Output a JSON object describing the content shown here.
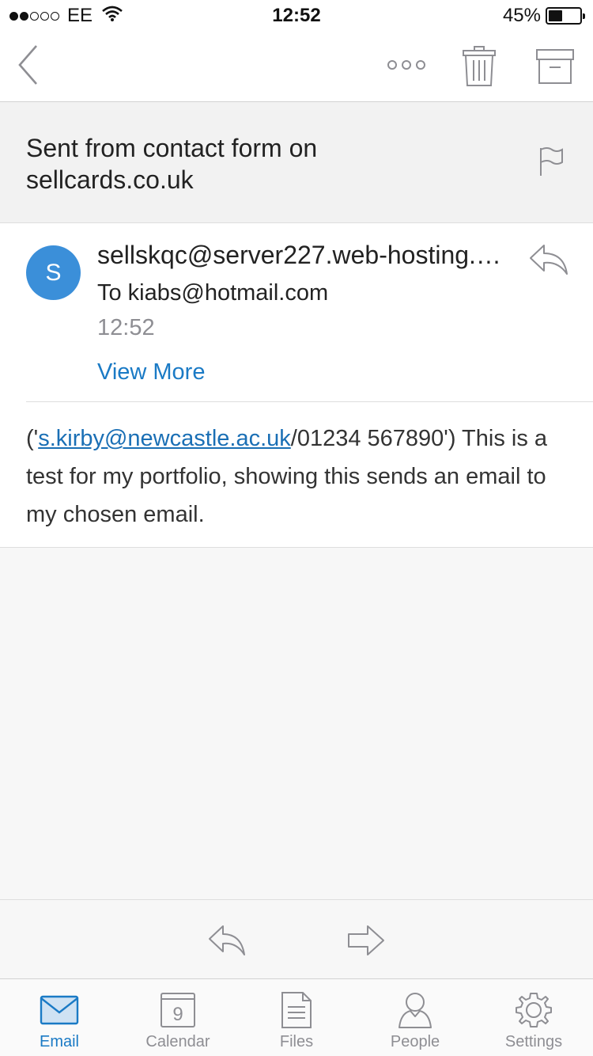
{
  "status_bar": {
    "signal_dots": [
      true,
      true,
      false,
      false,
      false
    ],
    "carrier": "EE",
    "time": "12:52",
    "battery": "45%",
    "battery_level": 0.45
  },
  "navbar": {
    "icons": [
      "back-chevron-icon",
      "more-options-icon",
      "trash-icon",
      "archive-icon"
    ]
  },
  "email": {
    "subject": "Sent from contact form on sellcards.co.uk",
    "avatar_initial": "S",
    "sender": "sellskqc@server227.web-hosting.com",
    "recipient": "To kiabs@hotmail.com",
    "time": "12:52",
    "view_more": "View More",
    "body": {
      "prefix": "('",
      "link": "s.kirby@newcastle.ac.uk",
      "suffix": "/01234 567890')",
      "text": "This is a test for my portfolio, showing this sends an email to my chosen email."
    }
  },
  "tabs": [
    {
      "label": "Email",
      "icon": "mail-icon",
      "active": true
    },
    {
      "label": "Calendar",
      "icon": "calendar-icon",
      "day": "9",
      "active": false
    },
    {
      "label": "Files",
      "icon": "files-icon",
      "active": false
    },
    {
      "label": "People",
      "icon": "person-icon",
      "active": false
    },
    {
      "label": "Settings",
      "icon": "gear-icon",
      "active": false
    }
  ],
  "colors": {
    "accent": "#1a7ac5",
    "avatar": "#3b8fd9",
    "icon_gray": "#8e8e93"
  }
}
